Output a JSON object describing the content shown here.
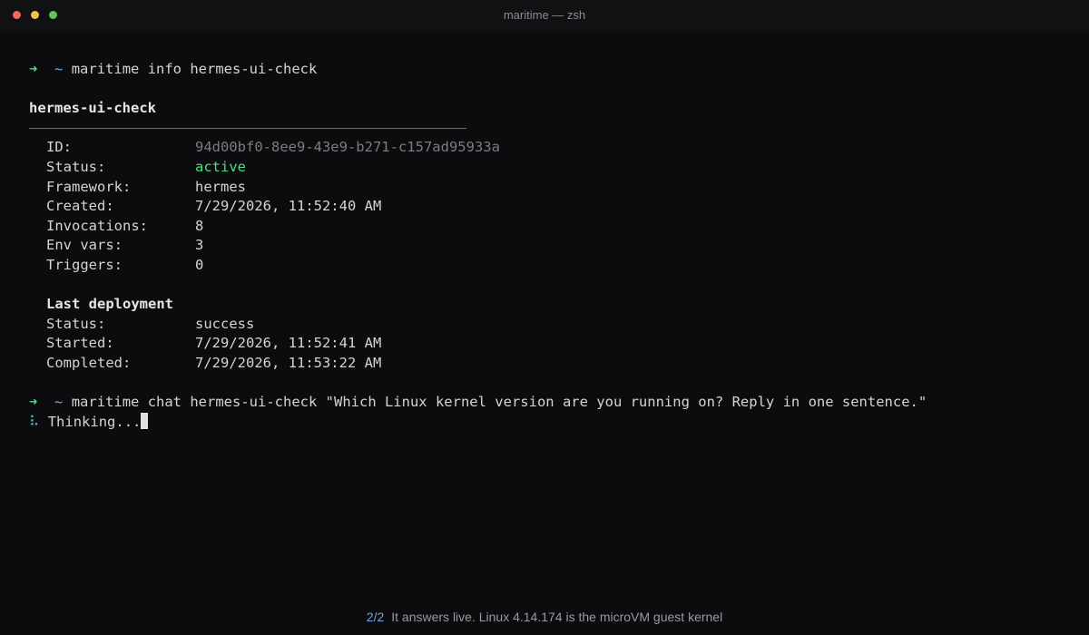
{
  "window": {
    "title": "maritime — zsh"
  },
  "prompt": {
    "arrow": "➜",
    "dir": "~"
  },
  "commands": {
    "info": "maritime info hermes-ui-check",
    "chat": "maritime chat hermes-ui-check \"Which Linux kernel version are you running on? Reply in one sentence.\""
  },
  "agent": {
    "name": "hermes-ui-check",
    "fields": [
      {
        "label": "ID:",
        "value": "94d00bf0-8ee9-43e9-b271-c157ad95933a"
      },
      {
        "label": "Status:",
        "value": "active"
      },
      {
        "label": "Framework:",
        "value": "hermes"
      },
      {
        "label": "Created:",
        "value": "7/29/2026, 11:52:40 AM"
      },
      {
        "label": "Invocations:",
        "value": "8"
      },
      {
        "label": "Env vars:",
        "value": "3"
      },
      {
        "label": "Triggers:",
        "value": "0"
      }
    ]
  },
  "deployment": {
    "heading": "Last deployment",
    "fields": [
      {
        "label": "Status:",
        "value": "success"
      },
      {
        "label": "Started:",
        "value": "7/29/2026, 11:52:41 AM"
      },
      {
        "label": "Completed:",
        "value": "7/29/2026, 11:53:22 AM"
      }
    ]
  },
  "thinking": {
    "spinner": "⠧",
    "text": "Thinking..."
  },
  "footer": {
    "step": "2/2",
    "caption": "It answers live. Linux 4.14.174 is the microVM guest kernel"
  },
  "colors": {
    "background": "#0c0c0e",
    "prompt_arrow": "#4ade80",
    "prompt_dir": "#5fb4d8",
    "status_active": "#4ade80",
    "id_value": "#7c7c82"
  }
}
